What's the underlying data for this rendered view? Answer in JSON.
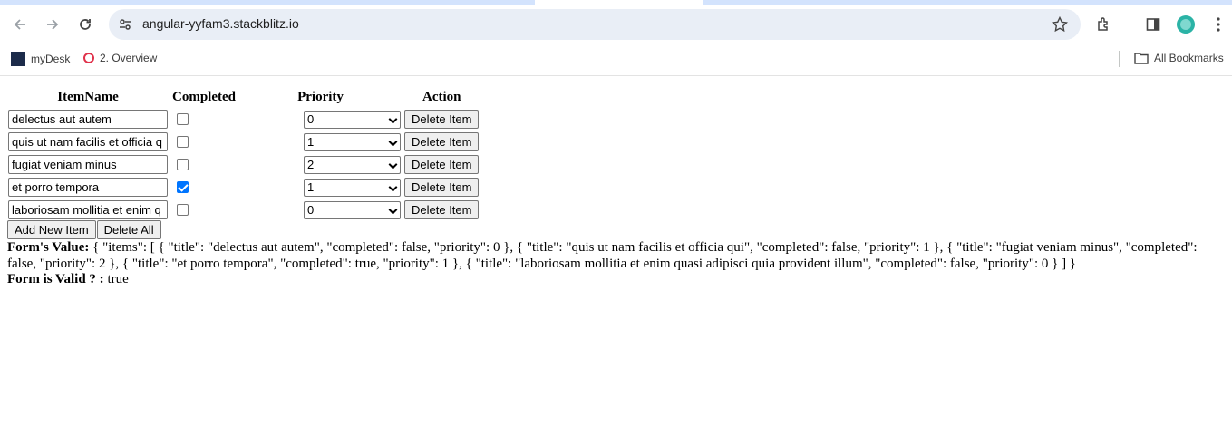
{
  "browser": {
    "url": "angular-yyfam3.stackblitz.io",
    "bookmarks": [
      {
        "label": "myDesk",
        "icon": "morgan-stanley-icon"
      },
      {
        "label": "2. Overview",
        "icon": "opera-icon"
      }
    ],
    "all_bookmarks": "All Bookmarks"
  },
  "table": {
    "headers": [
      "ItemName",
      "Completed",
      "Priority",
      "Action"
    ],
    "rows": [
      {
        "title": "delectus aut autem",
        "completed": false,
        "priority": "0",
        "action": "Delete Item"
      },
      {
        "title": "quis ut nam facilis et officia q",
        "completed": false,
        "priority": "1",
        "action": "Delete Item"
      },
      {
        "title": "fugiat veniam minus",
        "completed": false,
        "priority": "2",
        "action": "Delete Item"
      },
      {
        "title": "et porro tempora",
        "completed": true,
        "priority": "1",
        "action": "Delete Item"
      },
      {
        "title": "laboriosam mollitia et enim q",
        "completed": false,
        "priority": "0",
        "action": "Delete Item"
      }
    ]
  },
  "buttons": {
    "add": "Add New Item",
    "delete_all": "Delete All"
  },
  "form": {
    "value_label": "Form's Value:",
    "value_text": "{ \"items\": [ { \"title\": \"delectus aut autem\", \"completed\": false, \"priority\": 0 }, { \"title\": \"quis ut nam facilis et officia qui\", \"completed\": false, \"priority\": 1 }, { \"title\": \"fugiat veniam minus\", \"completed\": false, \"priority\": 2 }, { \"title\": \"et porro tempora\", \"completed\": true, \"priority\": 1 }, { \"title\": \"laboriosam mollitia et enim quasi adipisci quia provident illum\", \"completed\": false, \"priority\": 0 } ] }",
    "valid_label": "Form is Valid ? :",
    "valid_value": "true"
  }
}
